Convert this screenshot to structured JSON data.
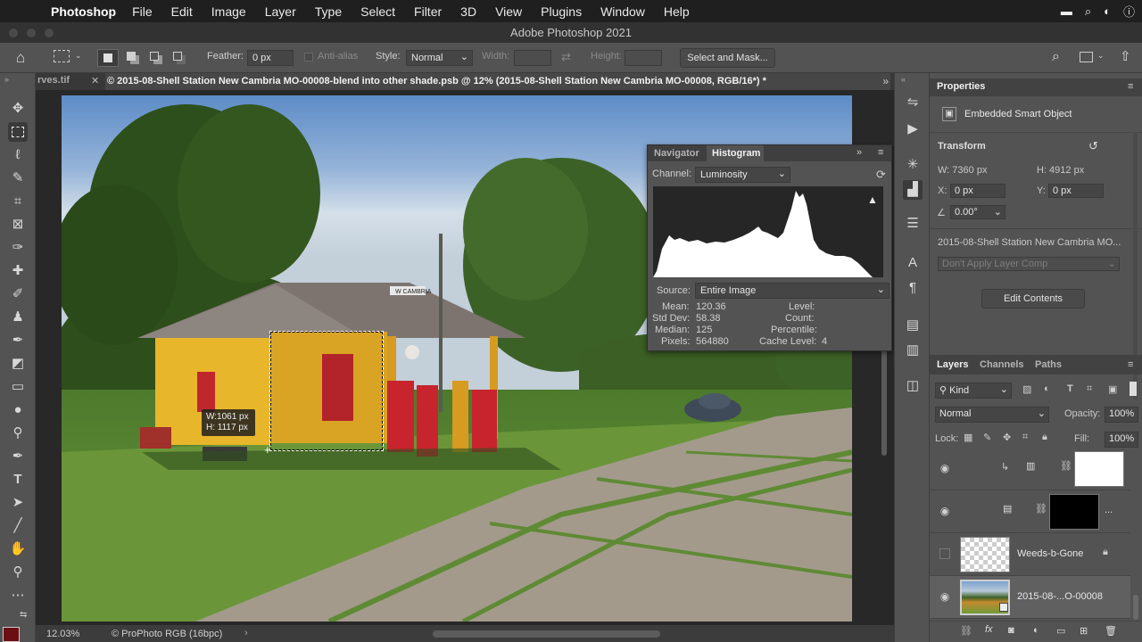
{
  "menubar": {
    "app": "Photoshop",
    "items": [
      "File",
      "Edit",
      "Image",
      "Layer",
      "Type",
      "Select",
      "Filter",
      "3D",
      "View",
      "Plugins",
      "Window",
      "Help"
    ]
  },
  "window": {
    "title": "Adobe Photoshop 2021"
  },
  "options": {
    "feather_label": "Feather:",
    "feather_value": "0 px",
    "antialias_label": "Anti-alias",
    "style_label": "Style:",
    "style_value": "Normal",
    "width_label": "Width:",
    "height_label": "Height:",
    "select_mask": "Select and Mask..."
  },
  "tabs": {
    "prev": "rves.tif",
    "active": "© 2015-08-Shell Station New Cambria MO-00008-blend into other shade.psb @ 12% (2015-08-Shell Station New Cambria MO-00008, RGB/16*) *"
  },
  "canvas": {
    "selection_w": "W:1061 px",
    "selection_h": "H: 1117 px",
    "sign_text": "W CAMBRIA"
  },
  "status": {
    "zoom": "12.03%",
    "profile": "© ProPhoto RGB (16bpc)"
  },
  "histogram": {
    "tab_navigator": "Navigator",
    "tab_histogram": "Histogram",
    "channel_label": "Channel:",
    "channel_value": "Luminosity",
    "source_label": "Source:",
    "source_value": "Entire Image",
    "stats_left": [
      {
        "label": "Mean:",
        "value": "120.36"
      },
      {
        "label": "Std Dev:",
        "value": "58.38"
      },
      {
        "label": "Median:",
        "value": "125"
      },
      {
        "label": "Pixels:",
        "value": "564880"
      }
    ],
    "stats_right": [
      {
        "label": "Level:",
        "value": ""
      },
      {
        "label": "Count:",
        "value": ""
      },
      {
        "label": "Percentile:",
        "value": ""
      },
      {
        "label": "Cache Level:",
        "value": "4"
      }
    ]
  },
  "properties": {
    "title": "Properties",
    "object_type": "Embedded Smart Object",
    "transform": "Transform",
    "w": "W: 7360 px",
    "h": "H: 4912 px",
    "x_label": "X:",
    "x_value": "0 px",
    "y_label": "Y:",
    "y_value": "0 px",
    "angle": "0.00°",
    "filename": "2015-08-Shell Station New Cambria MO...",
    "layer_comp": "Don't Apply Layer Comp",
    "edit_contents": "Edit Contents"
  },
  "layers_panel": {
    "tabs": [
      "Layers",
      "Channels",
      "Paths"
    ],
    "kind": "Kind",
    "blend_mode": "Normal",
    "opacity_label": "Opacity:",
    "opacity_value": "100%",
    "lock_label": "Lock:",
    "fill_label": "Fill:",
    "fill_value": "100%",
    "layers": [
      {
        "name": ""
      },
      {
        "name": "..."
      },
      {
        "name": "Weeds-b-Gone"
      },
      {
        "name": "2015-08-...O-00008"
      }
    ]
  }
}
